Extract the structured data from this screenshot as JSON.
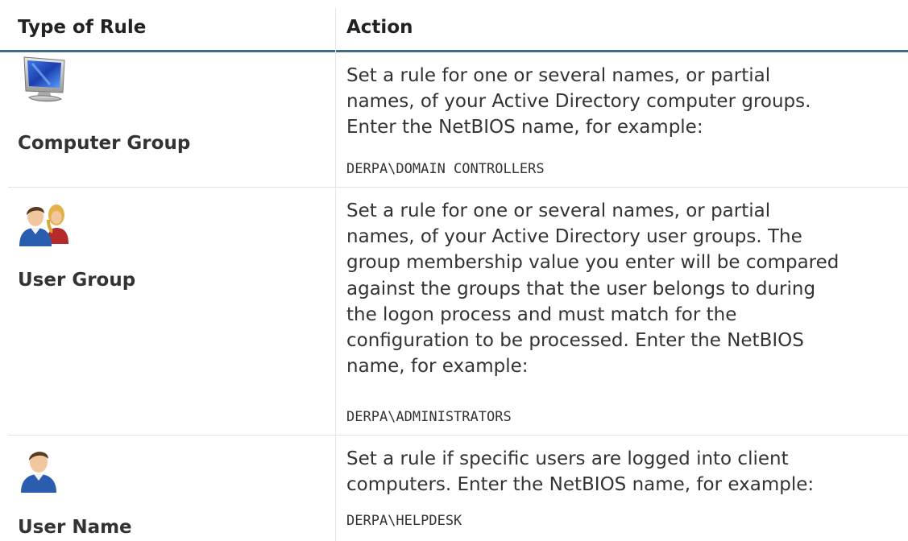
{
  "header": {
    "type_of_rule": "Type of Rule",
    "action": "Action"
  },
  "rows": [
    {
      "icon": "computer-monitor-icon",
      "name": "Computer Group",
      "desc_lines": [
        "Set a rule for one or several names, or partial",
        "names, of your Active Directory computer groups.",
        "Enter the NetBIOS name, for example:"
      ],
      "example": "DERPA\\DOMAIN CONTROLLERS"
    },
    {
      "icon": "user-group-icon",
      "name": "User Group",
      "desc_lines": [
        "Set a rule for one or several names, or partial",
        "names, of your Active Directory user groups. The",
        "group membership value you enter will be compared",
        "against the groups that the user belongs to during",
        "the logon process and must match for the",
        "configuration to be processed. Enter the NetBIOS",
        "name, for example:"
      ],
      "example": "DERPA\\ADMINISTRATORS"
    },
    {
      "icon": "user-icon",
      "name": "User Name",
      "desc_lines": [
        "Set a rule if specific users are logged into client",
        "computers. Enter the NetBIOS name, for example:"
      ],
      "example": "DERPA\\HELPDESK"
    }
  ],
  "colors": {
    "header_rule": "#3e6e84",
    "text": "#333333",
    "divider": "#e2e2e2"
  }
}
